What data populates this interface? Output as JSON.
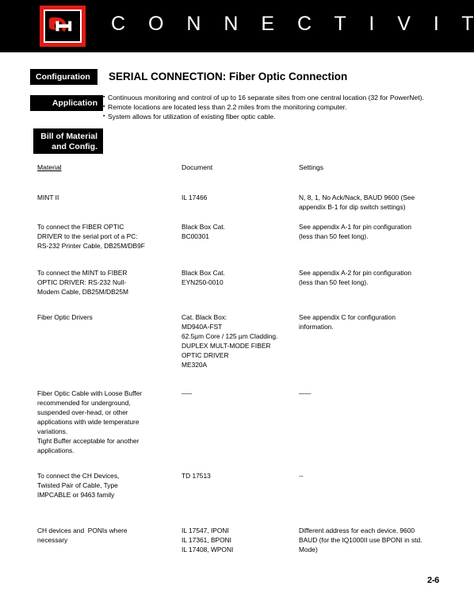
{
  "header": {
    "title": "C O N N E C T I V I T Y",
    "title_plain": "CONNECTIVITY",
    "logo_name": "company-logo",
    "colors": {
      "band": "#000000",
      "logo_red": "#e01b16",
      "logo_white": "#ffffff"
    }
  },
  "tabs": [
    {
      "label": "Configuration",
      "name": "tab-configuration"
    },
    {
      "label": "Application",
      "name": "tab-application"
    },
    {
      "label_line1": "Bill of Material",
      "label_line2": "and Config.",
      "name": "tab-bill-of-material"
    }
  ],
  "section": {
    "title": "SERIAL CONNECTION: Fiber Optic Connection",
    "bullets": [
      "Continuous monitoring and control of up to 16 separate sites from one central location (32 for PowerNet).",
      "Remote locations are located less than 2.2 miles from the monitoring computer.",
      "System allows for utilization of existing fiber optic cable."
    ]
  },
  "table": {
    "headers": {
      "material": "Material",
      "document": "Document",
      "settings": "Settings"
    },
    "rows": [
      {
        "material": [
          "MINT II"
        ],
        "document": [
          "IL 17466"
        ],
        "settings": [
          "N, 8, 1, No Ack/Nack, BAUD 9600 (See",
          "appendix B-1 for dip switch settings)"
        ]
      },
      {
        "material": [
          "To connect the FIBER OPTIC",
          "DRIVER to the serial port of a PC:",
          "RS-232 Printer Cable, DB25M/DB9F"
        ],
        "document": [
          "Black Box Cat.",
          "BC00301"
        ],
        "settings": [
          "See appendix A-1 for pin configuration",
          "(less than 50 feet long)."
        ]
      },
      {
        "material": [
          "To connect the MINT to FIBER",
          "OPTIC DRIVER: RS-232 Null-",
          "Modem Cable, DB25M/DB25M"
        ],
        "document": [
          "Black Box Cat.",
          "EYN250-0010"
        ],
        "settings": [
          "See appendix A-2 for pin configuration",
          "(less than 50 feet long)."
        ]
      },
      {
        "material": [
          "Fiber Optic Drivers"
        ],
        "document": [
          "Cat. Black Box:",
          "MD940A-FST",
          "62.5µm Core / 125 µm Cladding.",
          "DUPLEX MULT-MODE FIBER",
          "OPTIC DRIVER",
          "ME320A"
        ],
        "settings": [
          "See appendix C for configuration",
          "information."
        ]
      },
      {
        "material": [
          "Fiber Optic Cable with Loose Buffer",
          "recommended for underground,",
          "suspended over-head, or other",
          "applications with wide temperature",
          "variations.",
          "Tight Buffer acceptable for another",
          "applications."
        ],
        "document": [
          "—–"
        ],
        "settings": [
          "—–-"
        ]
      },
      {
        "material": [
          "To connect the CH Devices,",
          "Twisted Pair of Cable, Type",
          "IMPCABLE or 9463 family"
        ],
        "document": [
          "TD 17513"
        ],
        "settings": [
          "--"
        ]
      },
      {
        "material": [
          "CH devices and  PONIs where",
          "necessary"
        ],
        "document": [
          "IL 17547, IPONI",
          "IL 17361, BPONI",
          "IL 17408, WPONI"
        ],
        "settings": [
          "Different address for each device, 9600",
          "BAUD (for the IQ1000II use BPONI in std.",
          "Mode)"
        ]
      }
    ]
  },
  "footer": {
    "page_number": "2-6"
  }
}
